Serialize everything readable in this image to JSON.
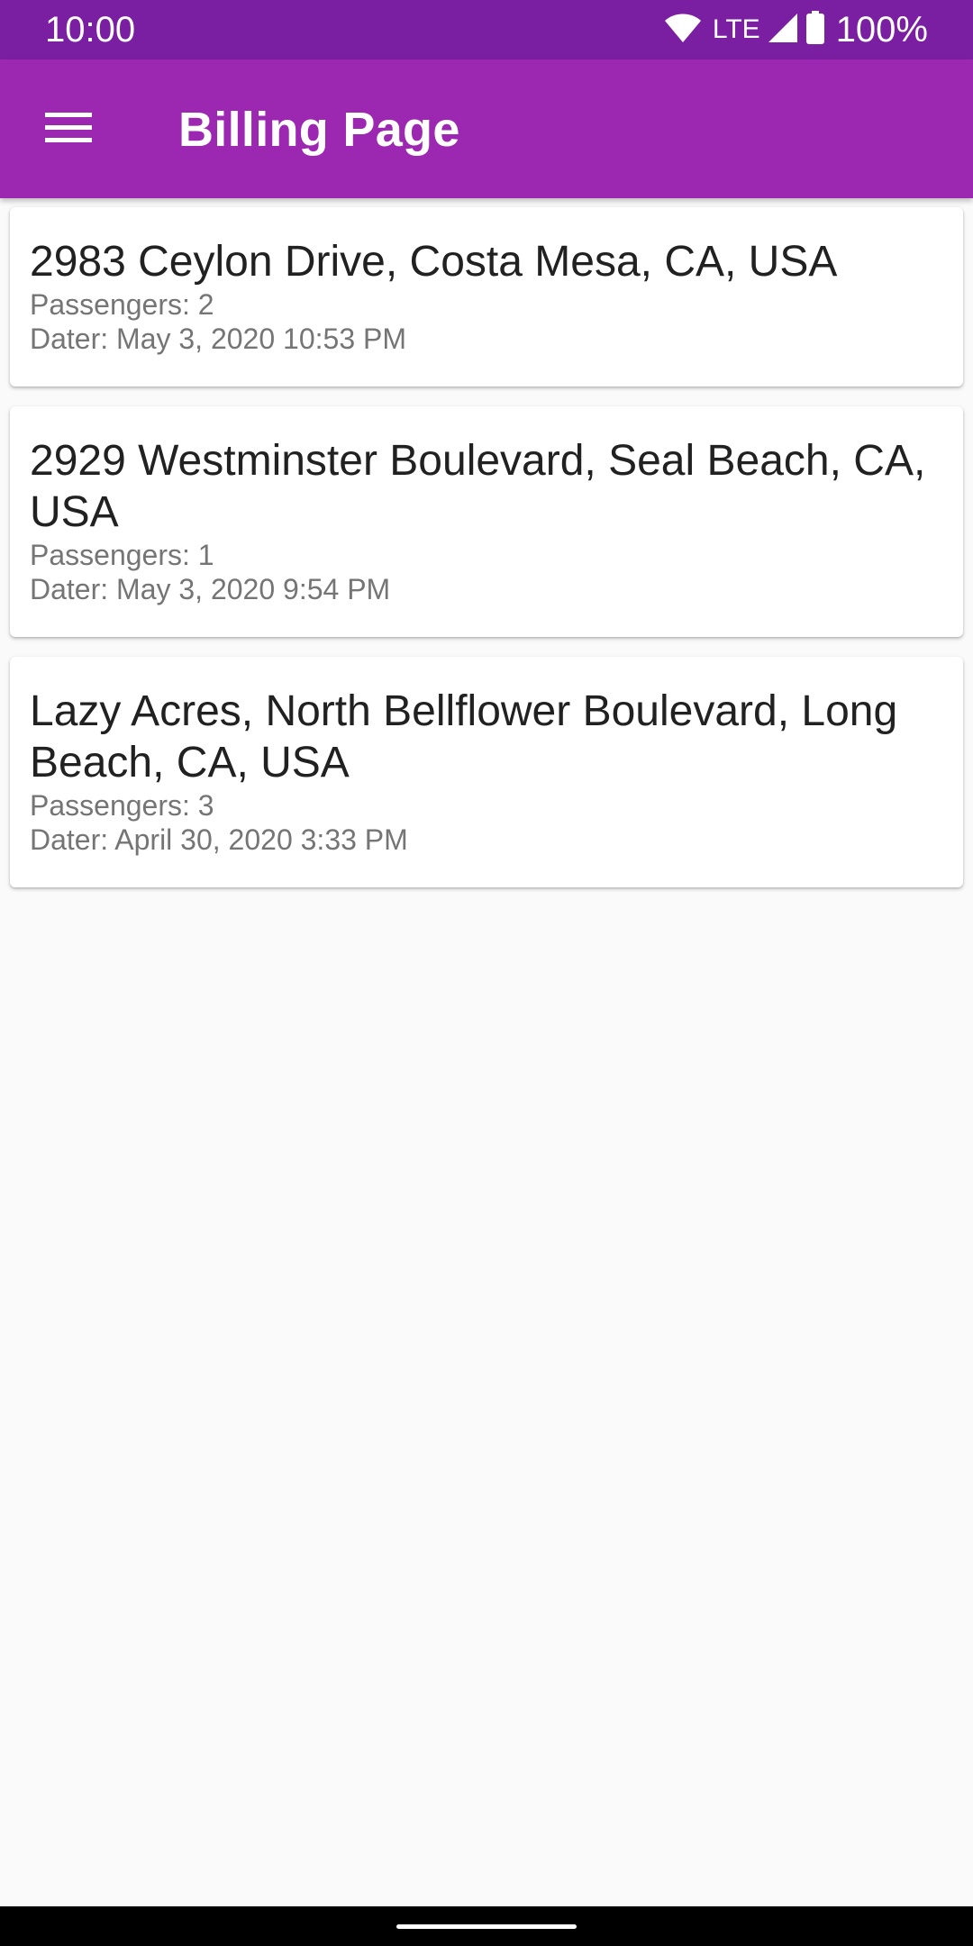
{
  "status_bar": {
    "time": "10:00",
    "network": "LTE",
    "battery": "100%",
    "icons": [
      "wifi-icon",
      "signal-icon",
      "battery-icon"
    ]
  },
  "app_bar": {
    "title": "Billing Page",
    "menu_icon": "menu-icon"
  },
  "colors": {
    "status_bar": "#7b1fa2",
    "app_bar": "#9c27b0",
    "background": "#fafafa",
    "card": "#ffffff",
    "primary_text": "#212121",
    "secondary_text": "#757575"
  },
  "rides": [
    {
      "address": "2983 Ceylon Drive, Costa Mesa, CA, USA",
      "passengers": "Passengers: 2",
      "date": "Dater: May 3, 2020 10:53 PM"
    },
    {
      "address": "2929 Westminster Boulevard, Seal Beach, CA, USA",
      "passengers": "Passengers: 1",
      "date": "Dater: May 3, 2020 9:54 PM"
    },
    {
      "address": "Lazy Acres, North Bellflower Boulevard, Long Beach, CA, USA",
      "passengers": "Passengers: 3",
      "date": "Dater: April 30, 2020 3:33 PM"
    }
  ]
}
